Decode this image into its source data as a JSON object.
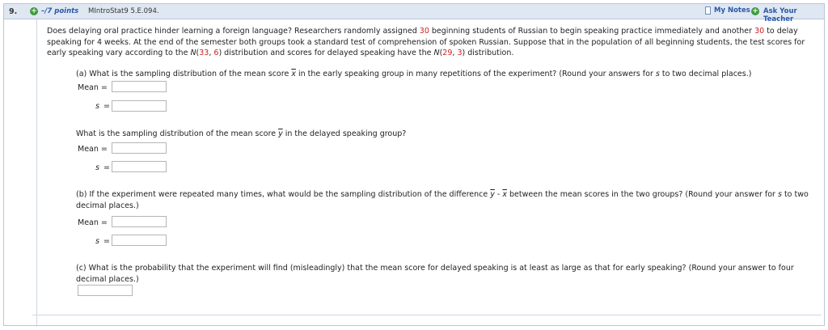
{
  "header": {
    "question_number": "9.",
    "points": "–/7 points",
    "source": "MIntroStat9 5.E.094.",
    "my_notes": "My Notes",
    "ask_teacher": "Ask Your Teacher"
  },
  "intro": {
    "t1": "Does delaying oral practice hinder learning a foreign language? Researchers randomly assigned ",
    "n1": "30",
    "t2": " beginning students of Russian to begin speaking practice immediately and another ",
    "n2": "30",
    "t3": " to delay speaking for 4 weeks. At the end of the semester both groups took a standard test of comprehension of spoken Russian. Suppose that in the population of all beginning students, the test scores for early speaking vary according to the ",
    "nlabel1": "N",
    "paren1_open": "(",
    "mu1": "33",
    "comma1": ", ",
    "sd1": "6",
    "t4": ") distribution and scores for delayed speaking have the ",
    "nlabel2": "N",
    "paren2_open": "(",
    "mu2": "29",
    "comma2": ", ",
    "sd2": "3",
    "t5": ") distribution."
  },
  "part_a": {
    "q1": "(a) What is the sampling distribution of the mean score ",
    "xvar": "x",
    "q2": " in the early speaking group in many repetitions of the experiment? (Round your answers for ",
    "svar": "s",
    "q3": " to two decimal places.)",
    "mean_label": "Mean =",
    "s_label": "s",
    "eq": "="
  },
  "part_a2": {
    "q1": "What is the sampling distribution of the mean score ",
    "yvar": "y",
    "q2": " in the delayed speaking group?",
    "mean_label": "Mean =",
    "s_label": "s",
    "eq": "="
  },
  "part_b": {
    "q1": "(b) If the experiment were repeated many times, what would be the sampling distribution of the difference ",
    "yvar": "y",
    "minus": " - ",
    "xvar": "x",
    "q2": " between the mean scores in the two groups? (Round your answer for ",
    "svar": "s",
    "q3": " to two decimal places.)",
    "mean_label": "Mean =",
    "s_label": "s",
    "eq": "="
  },
  "part_c": {
    "q1": "(c) What is the probability that the experiment will find (misleadingly) that the mean score for delayed speaking is at least as large as that for early speaking? (Round your answer to four decimal places.)"
  }
}
